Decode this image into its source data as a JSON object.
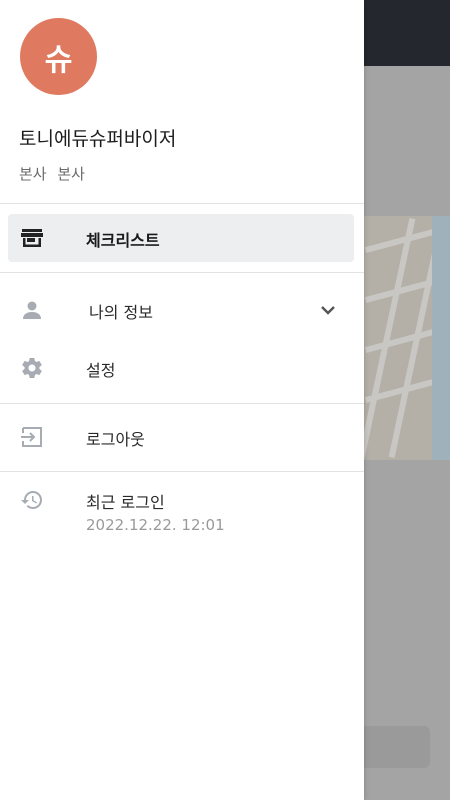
{
  "user": {
    "avatar_initial": "슈",
    "name": "토니에듀슈퍼바이저",
    "org": "본사 본사"
  },
  "menu": {
    "checklist": "체크리스트",
    "my_info": "나의 정보",
    "settings": "설정",
    "logout": "로그아웃",
    "recent_login_label": "최근 로그인",
    "recent_login_time": "2022.12.22. 12:01"
  },
  "colors": {
    "avatar_bg": "#df7a60",
    "active_bg": "#eceef0",
    "icon_gray": "#9aa0a8"
  }
}
